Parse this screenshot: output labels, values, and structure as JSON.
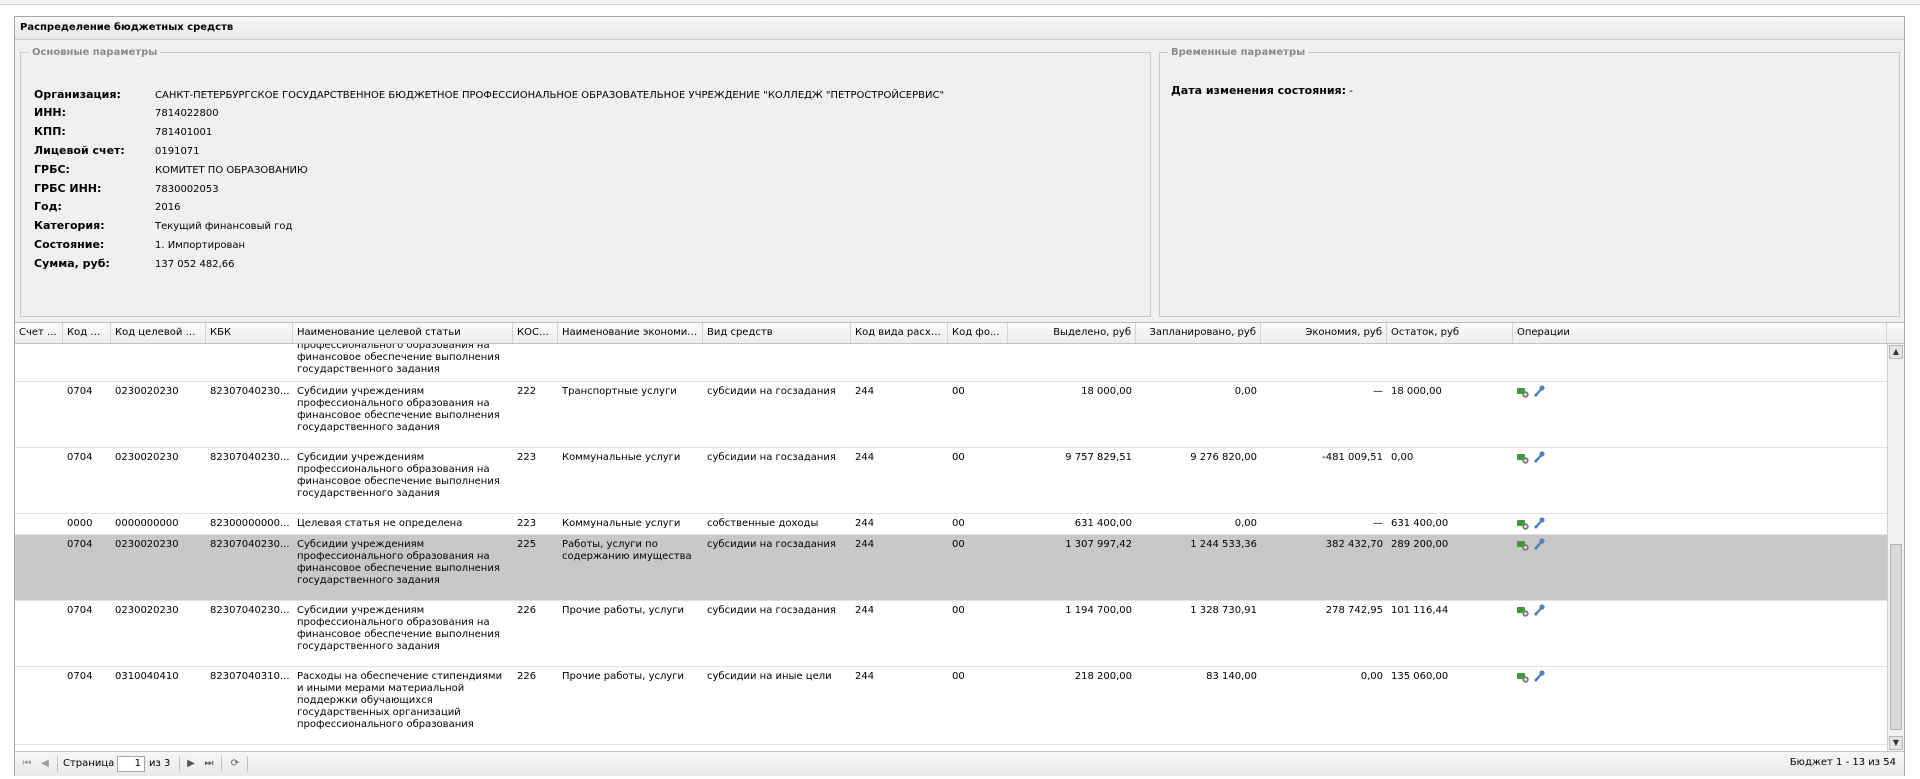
{
  "panel": {
    "title": "Распределение бюджетных средств"
  },
  "main_params": {
    "legend": "Основные параметры",
    "fields": [
      {
        "label": "Организация:",
        "value": "САНКТ-ПЕТЕРБУРГСКОЕ ГОСУДАРСТВЕННОЕ БЮДЖЕТНОЕ ПРОФЕССИОНАЛЬНОЕ ОБРАЗОВАТЕЛЬНОЕ УЧРЕЖДЕНИЕ \"КОЛЛЕДЖ \"ПЕТРОСТРОЙСЕРВИС\""
      },
      {
        "label": "ИНН:",
        "value": "7814022800"
      },
      {
        "label": "КПП:",
        "value": "781401001"
      },
      {
        "label": "Лицевой счет:",
        "value": "0191071"
      },
      {
        "label": "ГРБС:",
        "value": "КОМИТЕТ ПО ОБРАЗОВАНИЮ"
      },
      {
        "label": "ГРБС ИНН:",
        "value": "7830002053"
      },
      {
        "label": "Год:",
        "value": "2016"
      },
      {
        "label": "Категория:",
        "value": "Текущий финансовый год"
      },
      {
        "label": "Состояние:",
        "value": "1. Импортирован"
      },
      {
        "label": "Сумма, руб:",
        "value": "137 052 482,66"
      }
    ]
  },
  "time_params": {
    "legend": "Временные параметры",
    "label": "Дата изменения состояния:",
    "value": "-"
  },
  "grid": {
    "columns": [
      "Счет ...",
      "Код под...",
      "Код целевой ст...",
      "КБК",
      "Наименование целевой статьи",
      "КОСГ...",
      "Наименование экономич...",
      "Вид средств",
      "Код вида расхо...",
      "Код фо...",
      "Выделено, руб",
      "Запланировано, руб",
      "Экономия, руб",
      "Остаток, руб",
      "Операции"
    ],
    "partial_row": {
      "name": "профессионального образования на финансовое обеспечение выполнения государственного задания"
    },
    "rows": [
      {
        "podr": "0704",
        "celev": "0230020230",
        "kbk": "82307040230...",
        "name": "Субсидии учреждениям профессионального образования на финансовое обеспечение выполнения государственного задания",
        "kosgu": "222",
        "econ": "Транспортные услуги",
        "vid": "субсидии на госзадания",
        "kvr": "244",
        "kfo": "00",
        "alloc": "18 000,00",
        "plan": "0,00",
        "econ_sum": "—",
        "rest": "18 000,00",
        "selected": false
      },
      {
        "podr": "0704",
        "celev": "0230020230",
        "kbk": "82307040230...",
        "name": "Субсидии учреждениям профессионального образования на финансовое обеспечение выполнения государственного задания",
        "kosgu": "223",
        "econ": "Коммунальные услуги",
        "vid": "субсидии на госзадания",
        "kvr": "244",
        "kfo": "00",
        "alloc": "9 757 829,51",
        "plan": "9 276 820,00",
        "econ_sum": "-481 009,51",
        "rest": "0,00",
        "selected": false
      },
      {
        "podr": "0000",
        "celev": "0000000000",
        "kbk": "82300000000...",
        "name": "Целевая статья не определена",
        "kosgu": "223",
        "econ": "Коммунальные услуги",
        "vid": "собственные доходы",
        "kvr": "244",
        "kfo": "00",
        "alloc": "631 400,00",
        "plan": "0,00",
        "econ_sum": "—",
        "rest": "631 400,00",
        "selected": false
      },
      {
        "podr": "0704",
        "celev": "0230020230",
        "kbk": "82307040230...",
        "name": "Субсидии учреждениям профессионального образования на финансовое обеспечение выполнения государственного задания",
        "kosgu": "225",
        "econ": "Работы, услуги по содержанию имущества",
        "vid": "субсидии на госзадания",
        "kvr": "244",
        "kfo": "00",
        "alloc": "1 307 997,42",
        "plan": "1 244 533,36",
        "econ_sum": "382 432,70",
        "rest": "289 200,00",
        "selected": true
      },
      {
        "podr": "0704",
        "celev": "0230020230",
        "kbk": "82307040230...",
        "name": "Субсидии учреждениям профессионального образования на финансовое обеспечение выполнения государственного задания",
        "kosgu": "226",
        "econ": "Прочие работы, услуги",
        "vid": "субсидии на госзадания",
        "kvr": "244",
        "kfo": "00",
        "alloc": "1 194 700,00",
        "plan": "1 328 730,91",
        "econ_sum": "278 742,95",
        "rest": "101 116,44",
        "selected": false
      },
      {
        "podr": "0704",
        "celev": "0310040410",
        "kbk": "82307040310...",
        "name": "Расходы на обеспечение стипендиями и иными мерами материальной поддержки обучающихся государственных организаций профессионального образования",
        "kosgu": "226",
        "econ": "Прочие работы, услуги",
        "vid": "субсидии на иные цели",
        "kvr": "244",
        "kfo": "00",
        "alloc": "218 200,00",
        "plan": "83 140,00",
        "econ_sum": "0,00",
        "rest": "135 060,00",
        "selected": false
      }
    ]
  },
  "pager": {
    "page_label": "Страница",
    "page_value": "1",
    "of_label": "из 3",
    "info": "Бюджет 1 - 13 из 54"
  },
  "colors": {
    "selected_row": "#c8c8c8",
    "panel_bg": "#f0f0f0",
    "legend_text": "#8a8a8a"
  },
  "icons": [
    "money-gear-icon",
    "wrench-icon",
    "first-page-icon",
    "prev-page-icon",
    "next-page-icon",
    "last-page-icon",
    "refresh-icon"
  ]
}
